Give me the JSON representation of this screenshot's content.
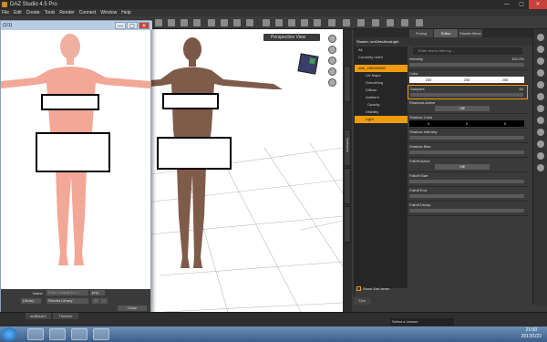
{
  "window": {
    "title": "DAZ Studio 4.5 Pro",
    "controls": [
      "—",
      "▢",
      "✕"
    ]
  },
  "menu": [
    "File",
    "Edit",
    "Create",
    "Tools",
    "Render",
    "Connect",
    "Window",
    "Help"
  ],
  "viewport": {
    "view_label": "Perspective View"
  },
  "side_tabs": [
    "Surfaces"
  ],
  "panel": {
    "tabs": [
      "Posing",
      "Editor",
      "Shader Mixer"
    ],
    "title": "Shader: omUberAreaLight",
    "tree": [
      "All",
      "Currently Used",
      "wire_255255255",
      "UV Maps",
      "Smoothing",
      "Diffuse",
      "Ambient",
      "Opacity",
      "Visibility",
      "Light"
    ],
    "filter_placeholder": "Enter text to filter by...",
    "props": {
      "intensity": {
        "label": "Intensity",
        "value": "401.0%"
      },
      "color": {
        "label": "Color",
        "r": "255",
        "g": "255",
        "b": "255"
      },
      "samples": {
        "label": "Samples",
        "value": "50"
      },
      "shadows_active": {
        "label": "Shadows Active",
        "value": "Off"
      },
      "shadow_color": {
        "label": "Shadow Color",
        "r": "0",
        "g": "0",
        "b": "0"
      },
      "shadow_intensity": {
        "label": "Shadow Intensity"
      },
      "shadow_bias": {
        "label": "Shadow Bias"
      },
      "falloff_active": {
        "label": "Falloff Active",
        "value": "Off"
      },
      "falloff_start": {
        "label": "Falloff Start"
      },
      "falloff_end": {
        "label": "Falloff End"
      },
      "falloff_decay": {
        "label": "Falloff Decay"
      }
    },
    "show_sub_items": "Show Sub Items",
    "tips": "Tips"
  },
  "dialog": {
    "title": "(1/1)",
    "name_label": "Name",
    "name_placeholder": "Enter a name for t...",
    "format": "png",
    "library": "Library",
    "render_library": "Render Library",
    "plus": "+",
    "minus": "-",
    "close": "Close"
  },
  "bottom": {
    "tabs": [
      "omBlade2",
      "Timeline"
    ],
    "lesson": "Select a Lesson"
  },
  "clock": {
    "time": "21:00",
    "date": "2013/1/22"
  }
}
